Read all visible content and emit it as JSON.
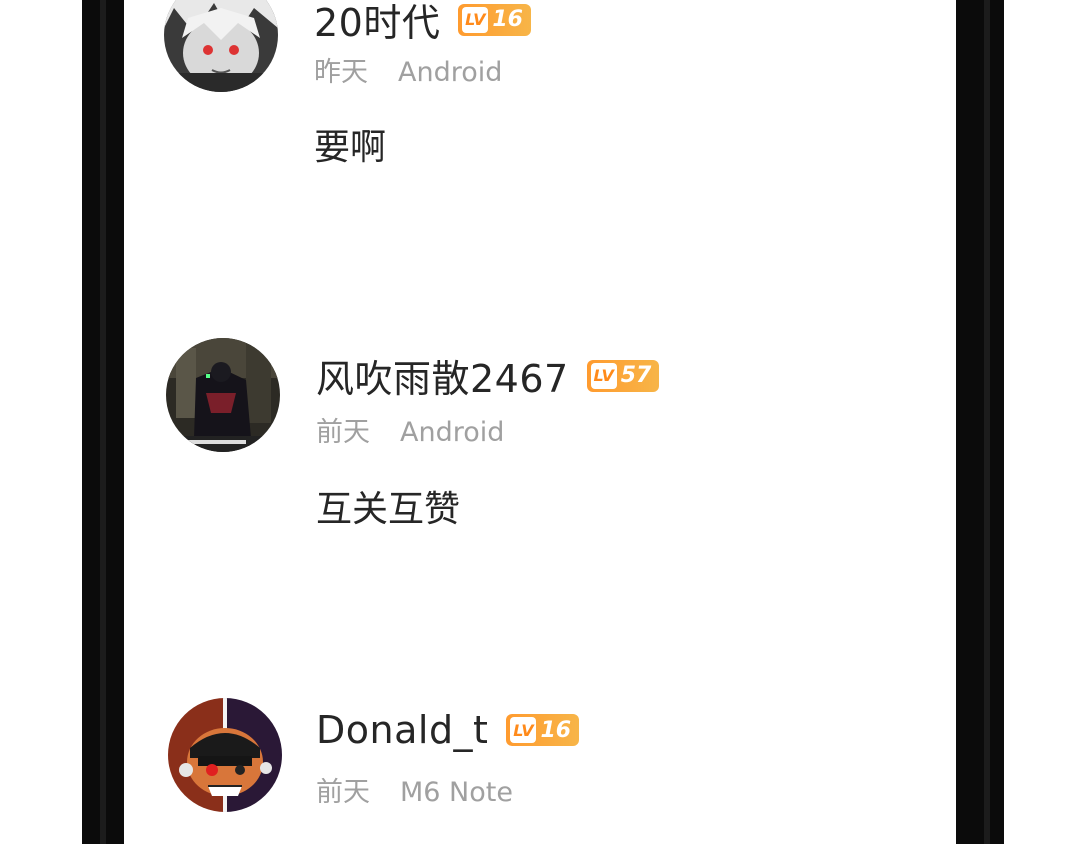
{
  "comments": [
    {
      "username": "20时代",
      "level": "16",
      "time": "昨天",
      "device": "Android",
      "content": "要啊"
    },
    {
      "username": "风吹雨散2467",
      "level": "57",
      "time": "前天",
      "device": "Android",
      "content": "互关互赞"
    },
    {
      "username": "Donald_t",
      "level": "16",
      "time": "前天",
      "device": "M6 Note",
      "content": ""
    }
  ],
  "badge_text": "LV",
  "colors": {
    "badge_start": "#ff9b2f",
    "badge_end": "#f7b548",
    "name": "#262626",
    "meta": "#a0a0a0"
  }
}
